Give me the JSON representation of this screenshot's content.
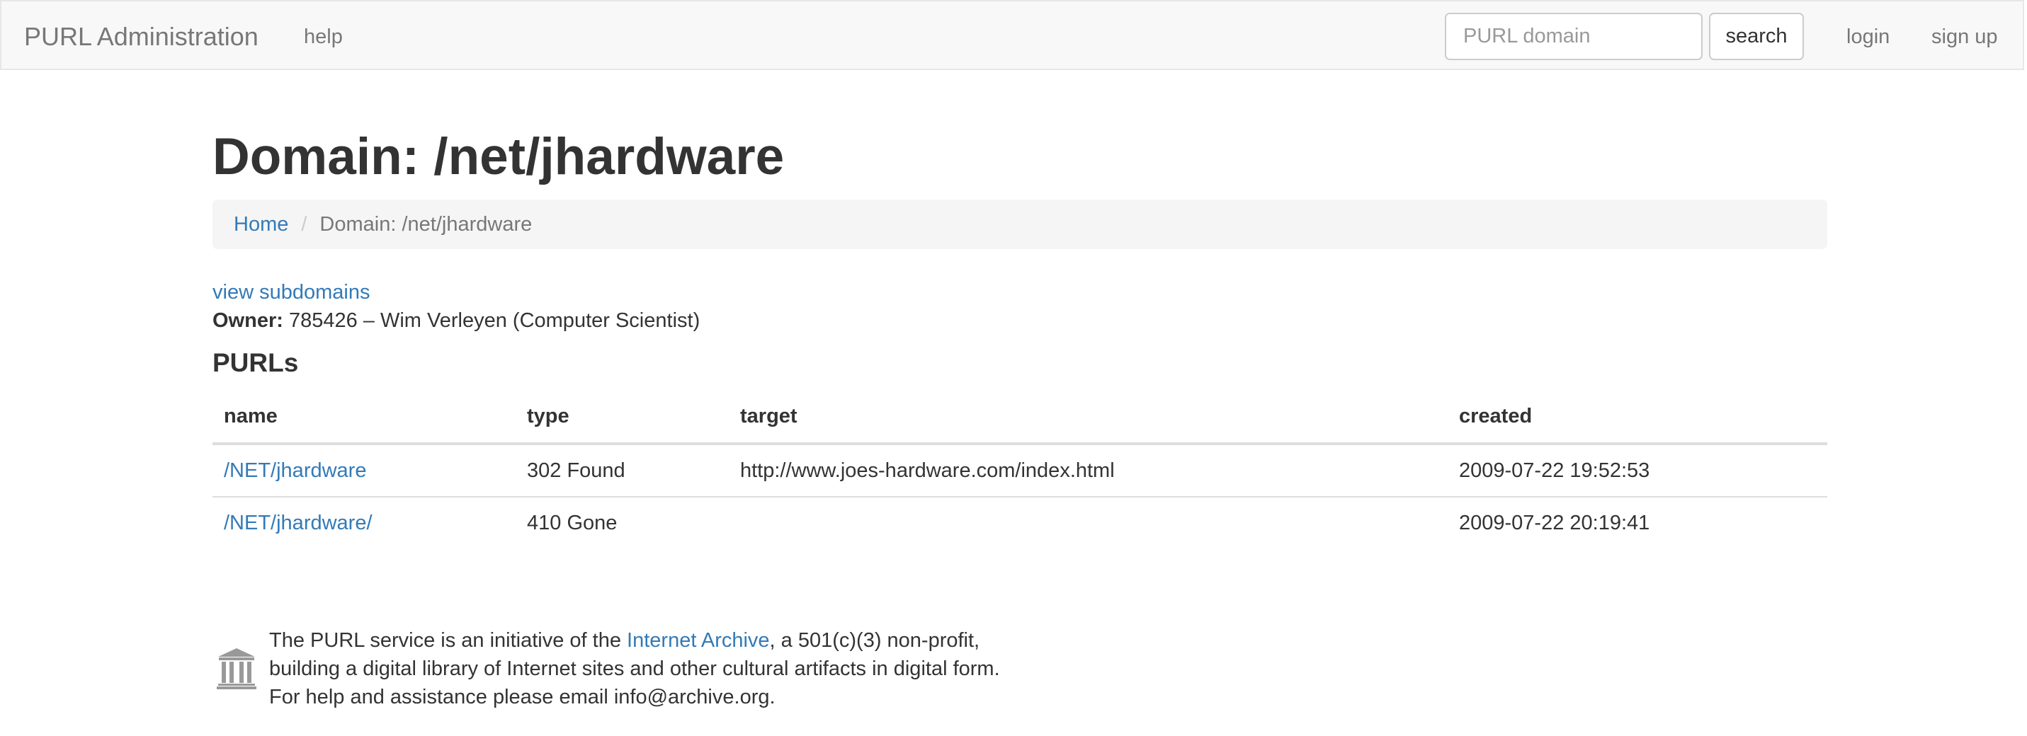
{
  "navbar": {
    "brand": "PURL Administration",
    "help_label": "help",
    "search_placeholder": "PURL domain",
    "search_button": "search",
    "login_label": "login",
    "signup_label": "sign up"
  },
  "page": {
    "title": "Domain: /net/jhardware"
  },
  "breadcrumb": {
    "home": "Home",
    "separator": "/",
    "current": "Domain: /net/jhardware"
  },
  "domain_info": {
    "view_subdomains": "view subdomains",
    "owner_label": "Owner:",
    "owner_value": "785426 – Wim Verleyen (Computer Scientist)"
  },
  "purls": {
    "heading": "PURLs",
    "columns": [
      "name",
      "type",
      "target",
      "created"
    ],
    "rows": [
      {
        "name": "/NET/jhardware",
        "type": "302 Found",
        "target": "http://www.joes-hardware.com/index.html",
        "created": "2009-07-22 19:52:53"
      },
      {
        "name": "/NET/jhardware/",
        "type": "410 Gone",
        "target": "",
        "created": "2009-07-22 20:19:41"
      }
    ]
  },
  "footer": {
    "icon": "archive-building-icon",
    "line1_prefix": "The PURL service is an initiative of the ",
    "line1_link": "Internet Archive",
    "line1_suffix": ", a 501(c)(3) non-profit,",
    "line2": "building a digital library of Internet sites and other cultural artifacts in digital form.",
    "line3": "For help and assistance please email info@archive.org."
  },
  "colors": {
    "link": "#337ab7",
    "navbar_bg": "#f8f8f8",
    "breadcrumb_bg": "#f5f5f5",
    "text": "#333333"
  }
}
